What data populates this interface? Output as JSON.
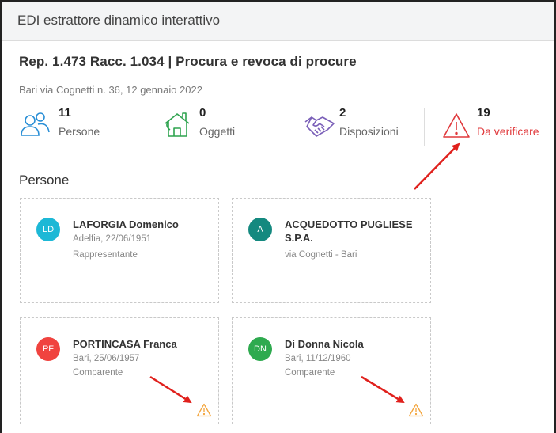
{
  "window": {
    "title": "EDI estrattore dinamico interattivo"
  },
  "header": {
    "title": "Rep. 1.473 Racc. 1.034 | Procura e revoca di procure",
    "subtitle": "Bari via Cognetti n. 36, 12 gennaio 2022"
  },
  "stats": [
    {
      "count": "11",
      "label": "Persone",
      "icon": "people-icon"
    },
    {
      "count": "0",
      "label": "Oggetti",
      "icon": "house-icon"
    },
    {
      "count": "2",
      "label": "Disposizioni",
      "icon": "handshake-icon"
    },
    {
      "count": "19",
      "label": "Da verificare",
      "icon": "warning-icon"
    }
  ],
  "section": {
    "title": "Persone"
  },
  "persons": [
    {
      "initials": "LD",
      "name": "LAFORGIA Domenico",
      "line1": "Adelfia, 22/06/1951",
      "line2": "Rappresentante",
      "color": "#1db8d6",
      "warning": false
    },
    {
      "initials": "A",
      "name": "ACQUEDOTTO PUGLIESE S.P.A.",
      "line1": "via Cognetti - Bari",
      "line2": "",
      "color": "#14897f",
      "warning": false
    },
    {
      "initials": "PF",
      "name": "PORTINCASA Franca",
      "line1": "Bari, 25/06/1957",
      "line2": "Comparente",
      "color": "#f0433f",
      "warning": true
    },
    {
      "initials": "DN",
      "name": "Di Donna Nicola",
      "line1": "Bari, 11/12/1960",
      "line2": "Comparente",
      "color": "#2eaa4f",
      "warning": true
    }
  ],
  "colors": {
    "warning": "#e0383b",
    "warning_small": "#f3a43a",
    "icon_blue": "#2a8fd6",
    "icon_green": "#2ea34f",
    "icon_purple": "#7a5fb8",
    "annotation_arrow": "#e0201c"
  }
}
